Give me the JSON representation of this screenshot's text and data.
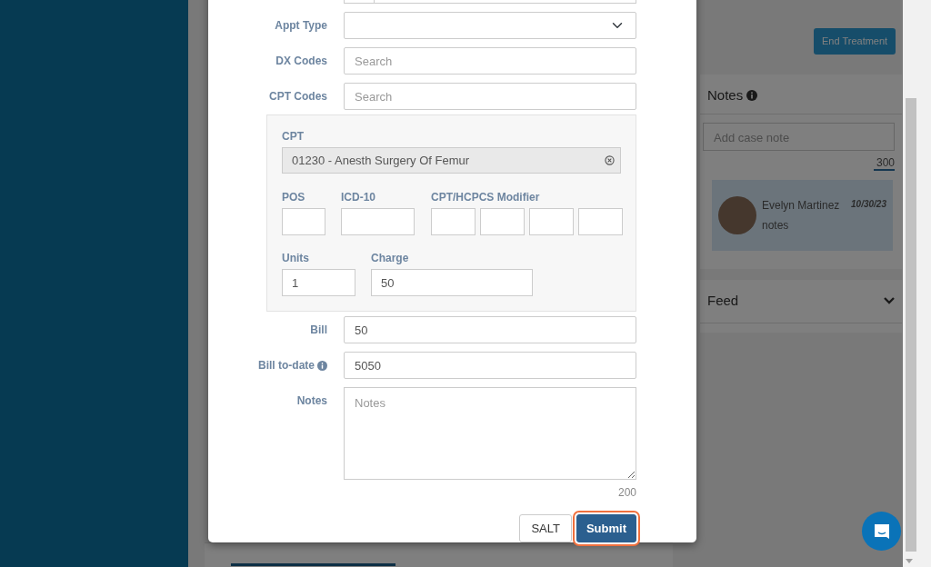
{
  "page": {
    "end_treatment": "End Treatment",
    "notes_panel": {
      "title": "Notes",
      "placeholder": "Add case note",
      "counter": "300",
      "entries": [
        {
          "author": "Evelyn Martinez",
          "date": "10/30/23",
          "text": "notes"
        }
      ]
    },
    "feed": {
      "title": "Feed",
      "expanded": false
    }
  },
  "modal": {
    "fields": [
      {
        "kind": "select",
        "label": "Appt Type"
      },
      {
        "kind": "input",
        "label": "DX Codes",
        "placeholder": "Search"
      },
      {
        "kind": "input",
        "label": "CPT Codes",
        "placeholder": "Search"
      }
    ],
    "cpt_panel": {
      "cpt_label": "CPT",
      "cpt_value": "01230 - Anesth Surgery Of Femur",
      "pos_label": "POS",
      "icd_label": "ICD-10",
      "modifier_label": "CPT/HCPCS Modifier",
      "units_label": "Units",
      "units_value": "1",
      "charge_label": "Charge",
      "charge_value": "50"
    },
    "bill_fields": [
      {
        "label": "Bill",
        "value": "50",
        "info": false
      },
      {
        "label": "Bill to-date",
        "value": "5050",
        "info": true
      }
    ],
    "notes": {
      "label": "Notes",
      "placeholder": "Notes",
      "counter": "200"
    },
    "buttons": [
      {
        "label": "SALT",
        "kind": "secondary",
        "focused": false
      },
      {
        "label": "Submit",
        "kind": "primary",
        "focused": true
      }
    ]
  }
}
